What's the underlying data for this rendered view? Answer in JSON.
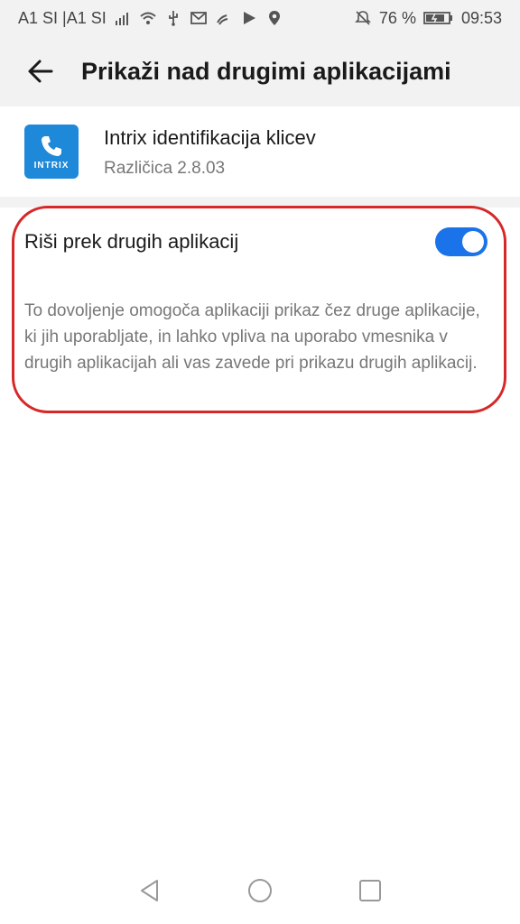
{
  "status_bar": {
    "carrier": "A1 SI |A1 SI",
    "battery_percent": "76 %",
    "time": "09:53"
  },
  "header": {
    "title": "Prikaži nad drugimi aplikacijami"
  },
  "app": {
    "name": "Intrix identifikacija klicev",
    "version": "Različica 2.8.03",
    "icon_logo_text": "INTRIX"
  },
  "setting": {
    "label": "Riši prek drugih aplikacij",
    "toggle_on": true,
    "description": "To dovoljenje omogoča aplikaciji prikaz čez druge aplikacije, ki jih uporabljate, in lahko vpliva na uporabo vmesnika v drugih aplikacijah ali vas zavede pri prikazu drugih aplikacij."
  },
  "colors": {
    "accent": "#1a73e8",
    "highlight": "#d62828",
    "app_icon": "#1e88d9"
  }
}
